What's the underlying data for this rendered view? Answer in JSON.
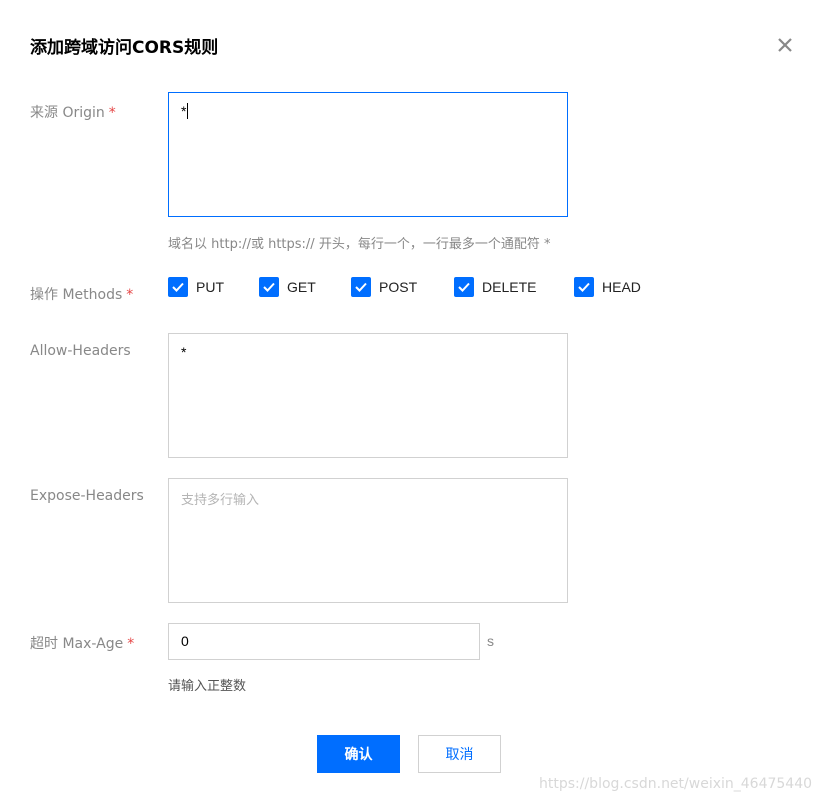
{
  "dialog": {
    "title": "添加跨域访问CORS规则",
    "close_icon": "close-icon"
  },
  "origin": {
    "label": "来源 Origin",
    "required": "*",
    "value": "*",
    "hint": "域名以 http://或 https:// 开头，每行一个，一行最多一个通配符 *"
  },
  "methods": {
    "label": "操作 Methods",
    "required": "*",
    "items": [
      {
        "label": "PUT",
        "checked": true
      },
      {
        "label": "GET",
        "checked": true
      },
      {
        "label": "POST",
        "checked": true
      },
      {
        "label": "DELETE",
        "checked": true
      },
      {
        "label": "HEAD",
        "checked": true
      }
    ]
  },
  "allow_headers": {
    "label": "Allow-Headers",
    "value": "*"
  },
  "expose_headers": {
    "label": "Expose-Headers",
    "placeholder": "支持多行输入"
  },
  "max_age": {
    "label": "超时 Max-Age",
    "required": "*",
    "value": "0",
    "unit": "s",
    "hint": "请输入正整数"
  },
  "footer": {
    "confirm_label": "确认",
    "cancel_label": "取消"
  },
  "watermark": "https://blog.csdn.net/weixin_46475440",
  "colors": {
    "accent": "#006eff",
    "required": "#e54545",
    "label": "#888888"
  }
}
